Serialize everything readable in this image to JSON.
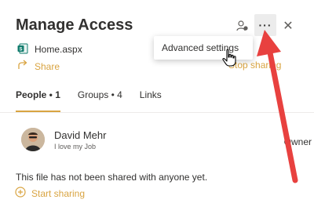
{
  "header": {
    "title": "Manage Access",
    "icons": [
      "people-settings-icon",
      "more-icon",
      "close-icon"
    ],
    "more_label": "···",
    "close_label": "✕"
  },
  "file": {
    "name": "Home.aspx",
    "icon": "sharepoint-page-icon"
  },
  "actions": {
    "share_label": "Share",
    "stop_sharing_label": "Stop sharing"
  },
  "tabs": [
    {
      "label": "People • 1",
      "active": true
    },
    {
      "label": "Groups • 4",
      "active": false
    },
    {
      "label": "Links",
      "active": false
    }
  ],
  "person": {
    "name": "David Mehr",
    "subtitle": "I love my Job",
    "role": "Owner"
  },
  "empty_state": {
    "message": "This file has not been shared with anyone yet.",
    "start_sharing_label": "Start sharing"
  },
  "menu": {
    "items": [
      "Advanced settings"
    ]
  },
  "colors": {
    "accent": "#d9a441",
    "annotation_arrow": "#e8413f",
    "text": "#323130"
  }
}
